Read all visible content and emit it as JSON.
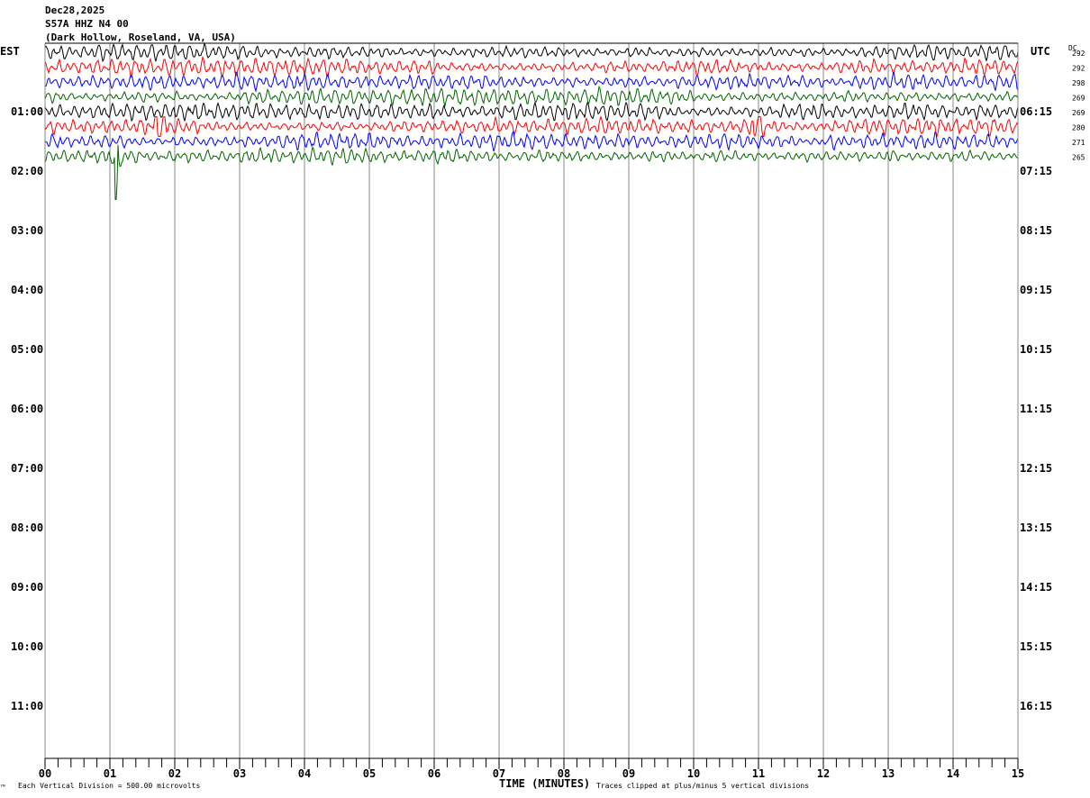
{
  "header": {
    "date": "Dec28,2025",
    "station": "S57A HHZ N4 00",
    "location": "(Dark Hollow, Roseland, VA, USA)"
  },
  "left_zone_label": "EST",
  "right_zone_label": "UTC",
  "dc_label": "DC",
  "footer": {
    "scale_note": "Each Vertical Division =  500.00 microvolts",
    "xlabel": "TIME (MINUTES)",
    "clip_note": "Traces clipped at plus/minus 5 vertical divisions",
    "corner_mark": "™"
  },
  "chart_data": {
    "type": "line",
    "title": "S57A HHZ N4 00 helicorder",
    "xlabel": "TIME (MINUTES)",
    "xlim": [
      0,
      15
    ],
    "x_ticks": [
      "00",
      "01",
      "02",
      "03",
      "04",
      "05",
      "06",
      "07",
      "08",
      "09",
      "10",
      "11",
      "12",
      "13",
      "14",
      "15"
    ],
    "minor_tick_seconds": 12,
    "est_hour_labels": [
      "",
      "01:00",
      "02:00",
      "03:00",
      "04:00",
      "05:00",
      "06:00",
      "07:00",
      "08:00",
      "09:00",
      "10:00",
      "11:00"
    ],
    "utc_hour_labels": [
      "",
      "06:15",
      "07:15",
      "08:15",
      "09:15",
      "10:15",
      "11:15",
      "12:15",
      "13:15",
      "14:15",
      "15:15",
      "16:15"
    ],
    "rows_total": 48,
    "trace_colors": [
      "#000000",
      "#ff0000",
      "#0000ff",
      "#006400"
    ],
    "traces": [
      {
        "dc": "292",
        "color": "#000000"
      },
      {
        "dc": "292",
        "color": "#ff0000"
      },
      {
        "dc": "298",
        "color": "#0000ff"
      },
      {
        "dc": "269",
        "color": "#006400"
      },
      {
        "dc": "269",
        "color": "#000000"
      },
      {
        "dc": "280",
        "color": "#ff0000"
      },
      {
        "dc": "271",
        "color": "#0000ff"
      },
      {
        "dc": "265",
        "color": "#006400"
      }
    ],
    "events": [
      {
        "trace": 5,
        "minute": 1.75
      },
      {
        "trace": 5,
        "minute": 10.95
      },
      {
        "trace": 7,
        "minute": 1.1
      },
      {
        "trace": 6,
        "minute": 12.2
      },
      {
        "trace": 7,
        "minute": 13.0
      }
    ]
  }
}
